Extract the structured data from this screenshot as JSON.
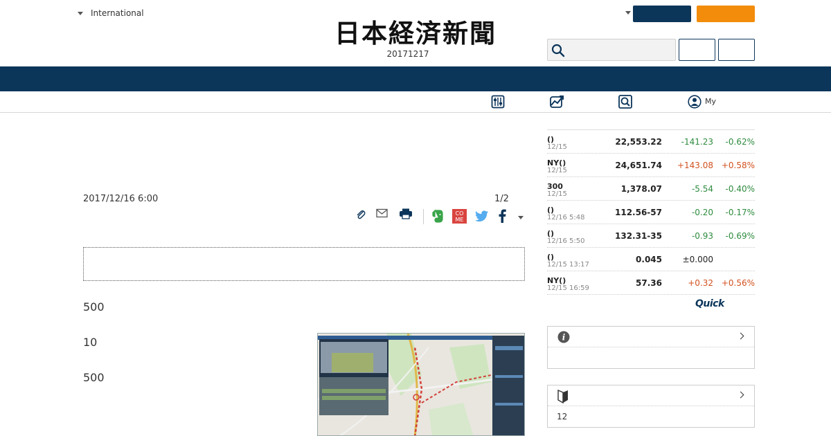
{
  "header": {
    "edition_label": "International",
    "logo_text": "日本経済新聞",
    "issue_date": "20171217",
    "search": {
      "placeholder": ""
    },
    "colors": {
      "navy": "#0c355a",
      "orange": "#f28c0a"
    }
  },
  "subnav": {
    "my_label": "My"
  },
  "article": {
    "published": "2017/12/16 6:00",
    "page_indicator": "1/2",
    "paragraphs": [
      "500",
      "10",
      "500"
    ]
  },
  "market": {
    "rows": [
      {
        "name": "()",
        "time": "12/15",
        "value": "22,553.22",
        "change": "-141.23",
        "percent": "-0.62%",
        "dir": "down"
      },
      {
        "name": "NY()",
        "time": "12/15",
        "value": "24,651.74",
        "change": "+143.08",
        "percent": "+0.58%",
        "dir": "up"
      },
      {
        "name": "300",
        "time": "12/15",
        "value": "1,378.07",
        "change": "-5.54",
        "percent": "-0.40%",
        "dir": "down"
      },
      {
        "name": "()",
        "time": "12/16 5:48",
        "value": "112.56-57",
        "change": "-0.20",
        "percent": "-0.17%",
        "dir": "down"
      },
      {
        "name": "()",
        "time": "12/16 5:50",
        "value": "132.31-35",
        "change": "-0.93",
        "percent": "-0.69%",
        "dir": "down"
      },
      {
        "name": "()",
        "time": "12/15 13:17",
        "value": "0.045",
        "change": "±0.000",
        "percent": "",
        "dir": "flat"
      },
      {
        "name": "NY()",
        "time": "12/15 16:59",
        "value": "57.36",
        "change": "+0.32",
        "percent": "+0.56%",
        "dir": "up"
      }
    ],
    "provider_logo": "Quick"
  },
  "sidebar": {
    "box2_body": "12"
  }
}
